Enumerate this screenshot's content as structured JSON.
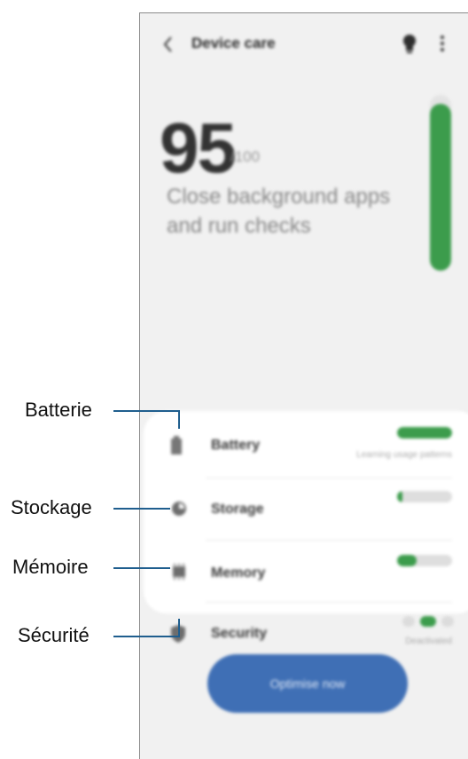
{
  "header": {
    "title": "Device care",
    "back_icon": "chevron-left-icon",
    "tips_icon": "lightbulb-icon",
    "more_icon": "more-vertical-icon"
  },
  "score": {
    "value": "95",
    "unit": "/100",
    "message": "Close background apps and run checks",
    "level_fraction": 0.95
  },
  "items": [
    {
      "key": "battery",
      "label": "Battery",
      "subtext": "Learning usage patterns",
      "icon": "battery-icon",
      "level_fraction": 1.0
    },
    {
      "key": "storage",
      "label": "Storage",
      "subtext": "",
      "icon": "storage-pie-icon",
      "level_fraction": 0.1
    },
    {
      "key": "memory",
      "label": "Memory",
      "subtext": "",
      "icon": "memory-chip-icon",
      "level_fraction": 0.35
    },
    {
      "key": "security",
      "label": "Security",
      "subtext": "Deactivated",
      "icon": "shield-icon"
    }
  ],
  "optimize_button": "Optimise now",
  "callouts": [
    "Batterie",
    "Stockage",
    "Mémoire",
    "Sécurité"
  ],
  "colors": {
    "accent_green": "#3c9c4c",
    "button_blue": "#3f6fb5",
    "callout_line": "#1f5e8e",
    "background": "#f1f1f1"
  }
}
